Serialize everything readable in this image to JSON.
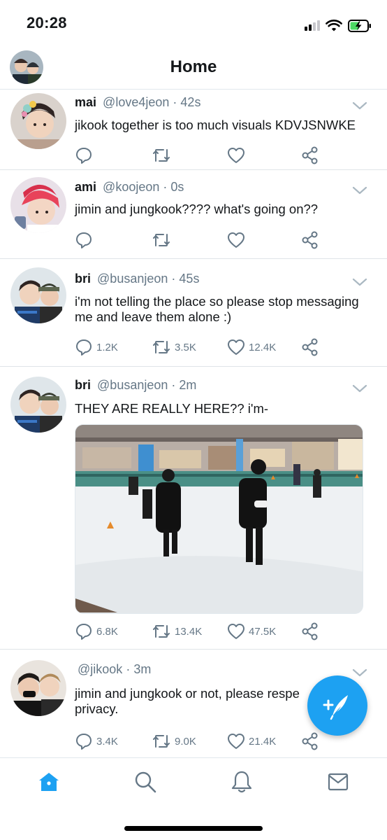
{
  "status": {
    "time": "20:28"
  },
  "header": {
    "title": "Home"
  },
  "tweets": [
    {
      "name": "mai",
      "handle": "@love4jeon",
      "time": "42s",
      "text": "jikook together is too much visuals KDVJSNWKE",
      "counts": {
        "reply": "",
        "retweet": "",
        "like": ""
      }
    },
    {
      "name": "ami",
      "handle": "@koojeon",
      "time": "0s",
      "text": "jimin and jungkook???? what's going on??",
      "counts": {
        "reply": "",
        "retweet": "",
        "like": ""
      }
    },
    {
      "name": "bri",
      "handle": "@busanjeon",
      "time": "45s",
      "text": "i'm not telling the place so please stop messaging me and leave them alone :)",
      "counts": {
        "reply": "1.2K",
        "retweet": "3.5K",
        "like": "12.4K"
      }
    },
    {
      "name": "bri",
      "handle": "@busanjeon",
      "time": "2m",
      "text": "THEY ARE REALLY HERE?? i'm-",
      "counts": {
        "reply": "6.8K",
        "retweet": "13.4K",
        "like": "47.5K"
      }
    },
    {
      "name": "",
      "handle": "@jikook",
      "time": "3m",
      "text": "jimin and jungkook or not, please respe",
      "text2": "privacy.",
      "counts": {
        "reply": "3.4K",
        "retweet": "9.0K",
        "like": "21.4K"
      }
    }
  ],
  "separator": "·",
  "colors": {
    "accent": "#1da1f2",
    "muted": "#657786",
    "text": "#14171a"
  },
  "icons": [
    "reply-icon",
    "retweet-icon",
    "like-icon",
    "share-icon",
    "compose-icon",
    "home-icon",
    "search-icon",
    "notifications-icon",
    "messages-icon"
  ]
}
